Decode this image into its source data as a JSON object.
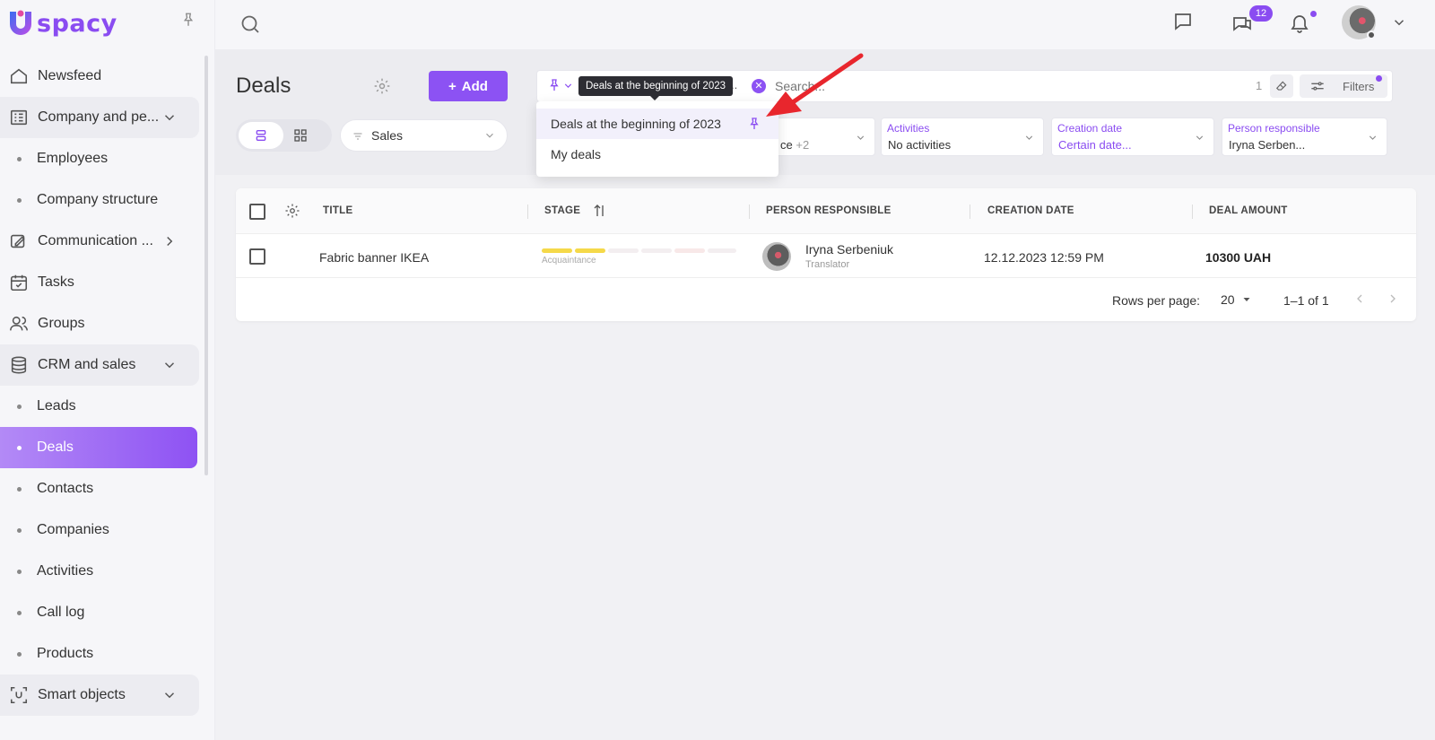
{
  "brand": {
    "logo_text": "spacy",
    "accent": "#8a4cf1"
  },
  "sidebar": {
    "items": [
      {
        "label": "Newsfeed"
      },
      {
        "label": "Company and pe..."
      },
      {
        "label": "Employees"
      },
      {
        "label": "Company structure"
      },
      {
        "label": "Communication ..."
      },
      {
        "label": "Tasks"
      },
      {
        "label": "Groups"
      },
      {
        "label": "CRM and sales"
      },
      {
        "label": "Leads"
      },
      {
        "label": "Deals"
      },
      {
        "label": "Contacts"
      },
      {
        "label": "Companies"
      },
      {
        "label": "Activities"
      },
      {
        "label": "Call log"
      },
      {
        "label": "Products"
      },
      {
        "label": "Smart objects"
      }
    ]
  },
  "topbar": {
    "chat_badge": "12"
  },
  "header": {
    "title": "Deals",
    "add_label": "Add",
    "pipeline": "Sales"
  },
  "search": {
    "chip_fragment": "..",
    "placeholder": "Search...",
    "count": "1",
    "filters_label": "Filters"
  },
  "tooltip": {
    "text": "Deals at the beginning of 2023"
  },
  "saved_filters": {
    "items": [
      {
        "label": "Deals at the beginning of 2023",
        "pinned": true
      },
      {
        "label": "My deals",
        "pinned": false
      }
    ]
  },
  "filters": [
    {
      "label": "",
      "value": "ce",
      "extra": "+2"
    },
    {
      "label": "Activities",
      "value": "No activities"
    },
    {
      "label": "Creation date",
      "value": "Certain date..."
    },
    {
      "label": "Person responsible",
      "value": "Iryna Serben..."
    }
  ],
  "table": {
    "columns": [
      "TITLE",
      "STAGE",
      "PERSON RESPONSIBLE",
      "CREATION DATE",
      "DEAL AMOUNT"
    ],
    "rows": [
      {
        "title": "Fabric banner IKEA",
        "stage": "Acquaintance",
        "person": "Iryna Serbeniuk",
        "role": "Translator",
        "created": "12.12.2023 12:59 PM",
        "amount": "10300 UAH"
      }
    ]
  },
  "pager": {
    "rows_label": "Rows per page:",
    "rows_value": "20",
    "range": "1–1 of 1"
  }
}
